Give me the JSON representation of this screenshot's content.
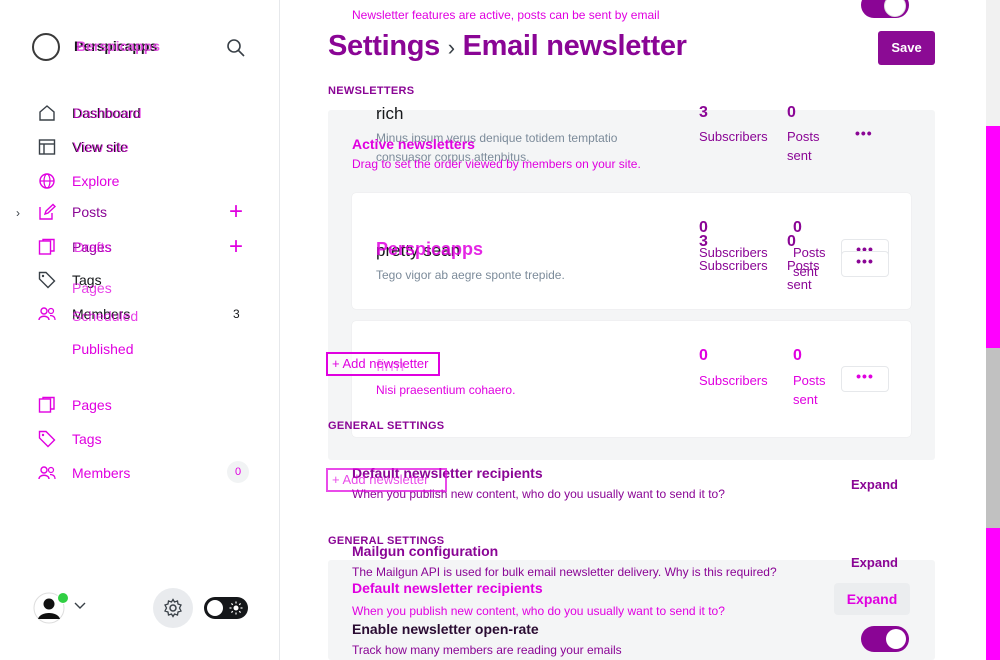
{
  "sidebar": {
    "brand_name": "Perspicapps",
    "brand_name_ghost": "Berspicapps",
    "nav": {
      "dashboard": "Dashboard",
      "view_site": "View site",
      "explore": "Explore",
      "posts": "Posts",
      "pages": "Pages",
      "tags": "Tags",
      "members": "Members",
      "members_count": "3"
    },
    "ghost_labels": {
      "dashboard": "Dashboard",
      "view_site": "View site",
      "drafts": "Drafts",
      "scheduled": "Scheduled",
      "published": "Published",
      "pages": "Pages",
      "tags": "Tags",
      "members": "Members",
      "members_count": "0"
    }
  },
  "main": {
    "top_banner": "Newsletter features are active, posts can be sent by email",
    "breadcrumb_root": "Settings",
    "breadcrumb_sep": "›",
    "breadcrumb_current": "Email newsletter",
    "save_label": "Save",
    "newsletters_heading": "NEWSLETTERS",
    "active_heading": "Active newsletters",
    "active_sub": "Drag to set the order viewed by members on your site.",
    "newsletters": [
      {
        "name": "rich",
        "description": "Minus ipsum verus denique totidem temptatio consuasor corpus attenbitus.",
        "subscribers": "3",
        "subscribers_label": "Subscribers",
        "posts_sent": "0",
        "posts_label": "Posts sent"
      },
      {
        "name": "pretty sean",
        "name_ghost": "Perspicapps",
        "description": "Tego vigor ab aegre sponte trepide.",
        "subscribers": "3",
        "subscribers_ghost": "0",
        "subscribers_label": "Subscribers",
        "posts_sent": "0",
        "posts_ghost": "0",
        "posts_label": "Posts sent"
      },
      {
        "name": "firm",
        "description": "Nisi praesentium cohaero.",
        "subscribers": "0",
        "subscribers_label": "Subscribers",
        "posts_sent": "0",
        "posts_label": "Posts sent"
      }
    ],
    "add_newsletter": "Add newsletter",
    "general_heading": "GENERAL SETTINGS",
    "settings": [
      {
        "title": "Default newsletter recipients",
        "desc": "When you publish new content, who do you usually want to send it to?",
        "action": "Expand"
      },
      {
        "title": "Mailgun configuration",
        "desc": "The Mailgun API is used for bulk email newsletter delivery. Why is this required?",
        "action": "Expand"
      },
      {
        "title": "Enable newsletter open-rate",
        "desc": "Track how many members are reading your emails"
      }
    ],
    "ghost_setting": {
      "title": "Default newsletter recipients",
      "desc": "When you publish new content, who do you usually want to send it to?",
      "action": "Expand"
    }
  },
  "colors": {
    "accent": "#8a0595",
    "magenta": "#e000e0",
    "online": "#30cf43"
  },
  "icons": [
    "search-icon",
    "home-icon",
    "browser-icon",
    "globe-icon",
    "pencil-icon",
    "pages-icon",
    "tag-icon",
    "members-icon",
    "plus-icon",
    "gear-icon",
    "moon-sun-icon",
    "chevron-down-icon",
    "chevron-right-icon",
    "more-icon"
  ]
}
